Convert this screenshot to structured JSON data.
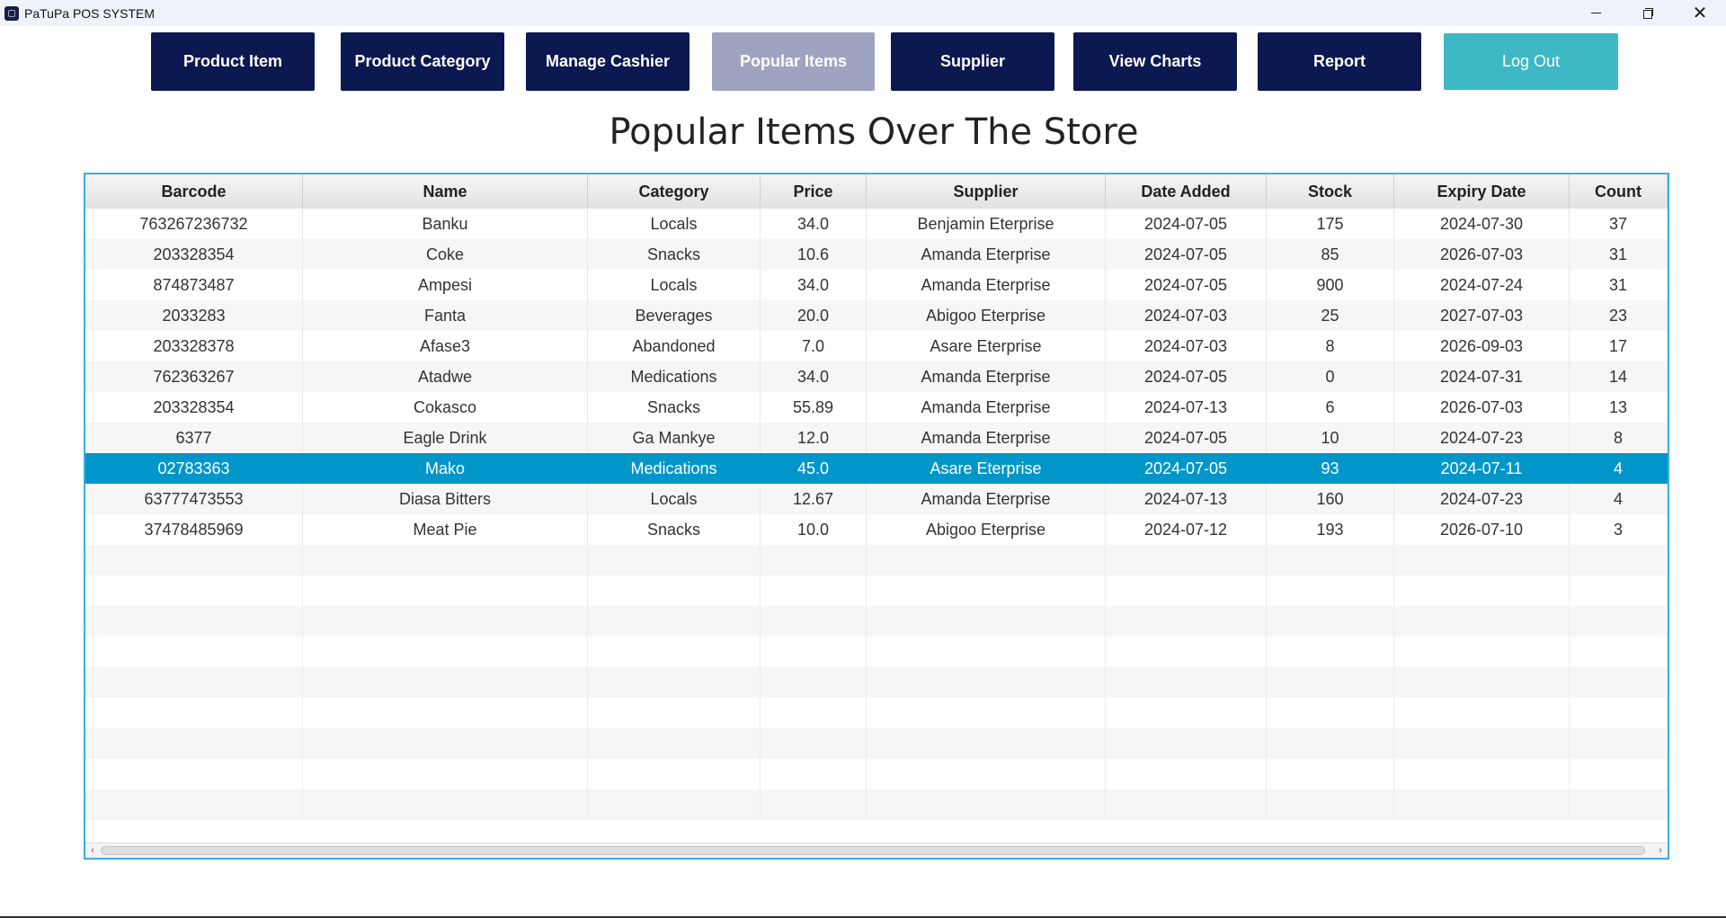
{
  "window": {
    "title": "PaTuPa POS SYSTEM",
    "controls": [
      "minimize-icon",
      "maximize-icon",
      "close-icon"
    ],
    "close_glyph": "✕"
  },
  "nav": {
    "product_item": "Product Item",
    "product_category": "Product Category",
    "manage_cashier": "Manage Cashier",
    "popular_items": "Popular Items",
    "supplier": "Supplier",
    "view_charts": "View Charts",
    "report": "Report",
    "logout": "Log Out",
    "active": "Popular Items"
  },
  "page": {
    "heading": "Popular Items Over The Store"
  },
  "colors": {
    "nav_bg": "#0c1850",
    "nav_active_bg": "#9ea4bf",
    "logout_bg": "#3db8c4",
    "selected_row": "#0096c9",
    "table_border": "#3aaee0"
  },
  "table": {
    "columns": [
      "Barcode",
      "Name",
      "Category",
      "Price",
      "Supplier",
      "Date Added",
      "Stock",
      "Expiry Date",
      "Count"
    ],
    "selected_index": 8,
    "rows": [
      [
        "763267236732",
        "Banku",
        "Locals",
        "34.0",
        "Benjamin Eterprise",
        "2024-07-05",
        "175",
        "2024-07-30",
        "37"
      ],
      [
        "203328354",
        "Coke",
        "Snacks",
        "10.6",
        "Amanda Eterprise",
        "2024-07-05",
        "85",
        "2026-07-03",
        "31"
      ],
      [
        "874873487",
        "Ampesi",
        "Locals",
        "34.0",
        "Amanda Eterprise",
        "2024-07-05",
        "900",
        "2024-07-24",
        "31"
      ],
      [
        "2033283",
        "Fanta",
        "Beverages",
        "20.0",
        "Abigoo Eterprise",
        "2024-07-03",
        "25",
        "2027-07-03",
        "23"
      ],
      [
        "203328378",
        "Afase3",
        "Abandoned",
        "7.0",
        "Asare Eterprise",
        "2024-07-03",
        "8",
        "2026-09-03",
        "17"
      ],
      [
        "762363267",
        "Atadwe",
        "Medications",
        "34.0",
        "Amanda Eterprise",
        "2024-07-05",
        "0",
        "2024-07-31",
        "14"
      ],
      [
        "203328354",
        "Cokasco",
        "Snacks",
        "55.89",
        "Amanda Eterprise",
        "2024-07-13",
        "6",
        "2026-07-03",
        "13"
      ],
      [
        "6377",
        "Eagle Drink",
        "Ga Mankye",
        "12.0",
        "Amanda Eterprise",
        "2024-07-05",
        "10",
        "2024-07-23",
        "8"
      ],
      [
        "02783363",
        "Mako",
        "Medications",
        "45.0",
        "Asare Eterprise",
        "2024-07-05",
        "93",
        "2024-07-11",
        "4"
      ],
      [
        "63777473553",
        "Diasa Bitters",
        "Locals",
        "12.67",
        "Amanda Eterprise",
        "2024-07-13",
        "160",
        "2024-07-23",
        "4"
      ],
      [
        "37478485969",
        "Meat Pie",
        "Snacks",
        "10.0",
        "Abigoo Eterprise",
        "2024-07-12",
        "193",
        "2026-07-10",
        "3"
      ]
    ]
  }
}
